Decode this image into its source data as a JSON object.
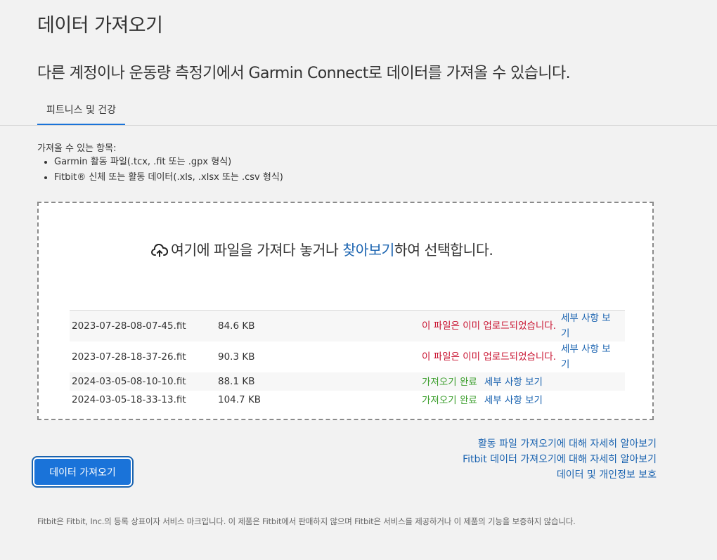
{
  "page": {
    "title": "데이터 가져오기",
    "intro": "다른 계정이나 운동량 측정기에서 Garmin Connect로 데이터를 가져올 수 있습니다."
  },
  "tabs": [
    {
      "label": "피트니스 및 건강",
      "active": true
    }
  ],
  "importable": {
    "heading": "가져올 수 있는 항목:",
    "items": [
      "Garmin 활동 파일(.tcx, .fit 또는 .gpx 형식)",
      "Fitbit® 신체 또는 활동 데이터(.xls, .xlsx 또는 .csv 형식)"
    ]
  },
  "dropzone": {
    "icon": "cloud-upload-icon",
    "before": "여기에 파일을 가져다 놓거나 ",
    "browse": "찾아보기",
    "after": "하여 선택합니다."
  },
  "files": [
    {
      "name": "2023-07-28-08-07-45.fit",
      "size": "84.6 KB",
      "status": "이 파일은 이미 업로드되었습니다.",
      "status_type": "error",
      "details": "세부 사항 보기"
    },
    {
      "name": "2023-07-28-18-37-26.fit",
      "size": "90.3 KB",
      "status": "이 파일은 이미 업로드되었습니다.",
      "status_type": "error",
      "details": "세부 사항 보기"
    },
    {
      "name": "2024-03-05-08-10-10.fit",
      "size": "88.1 KB",
      "status": "가져오기 완료",
      "status_type": "success",
      "details": "세부 사항 보기"
    },
    {
      "name": "2024-03-05-18-33-13.fit",
      "size": "104.7 KB",
      "status": "가져오기 완료",
      "status_type": "success",
      "details": "세부 사항 보기"
    }
  ],
  "links": [
    "활동 파일 가져오기에 대해 자세히 알아보기",
    "Fitbit 데이터 가져오기에 대해 자세히 알아보기",
    "데이터 및 개인정보 보호"
  ],
  "import_button": "데이터 가져오기",
  "footer": "Fitbit은 Fitbit, Inc.의 등록 상표이자 서비스 마크입니다. 이 제품은 Fitbit에서 판매하지 않으며 Fitbit은 서비스를 제공하거나 이 제품의 기능을 보증하지 않습니다.",
  "colors": {
    "accent": "#1a73d9",
    "link": "#1a63b0",
    "error": "#c8102e",
    "success": "#3b9e2c"
  }
}
